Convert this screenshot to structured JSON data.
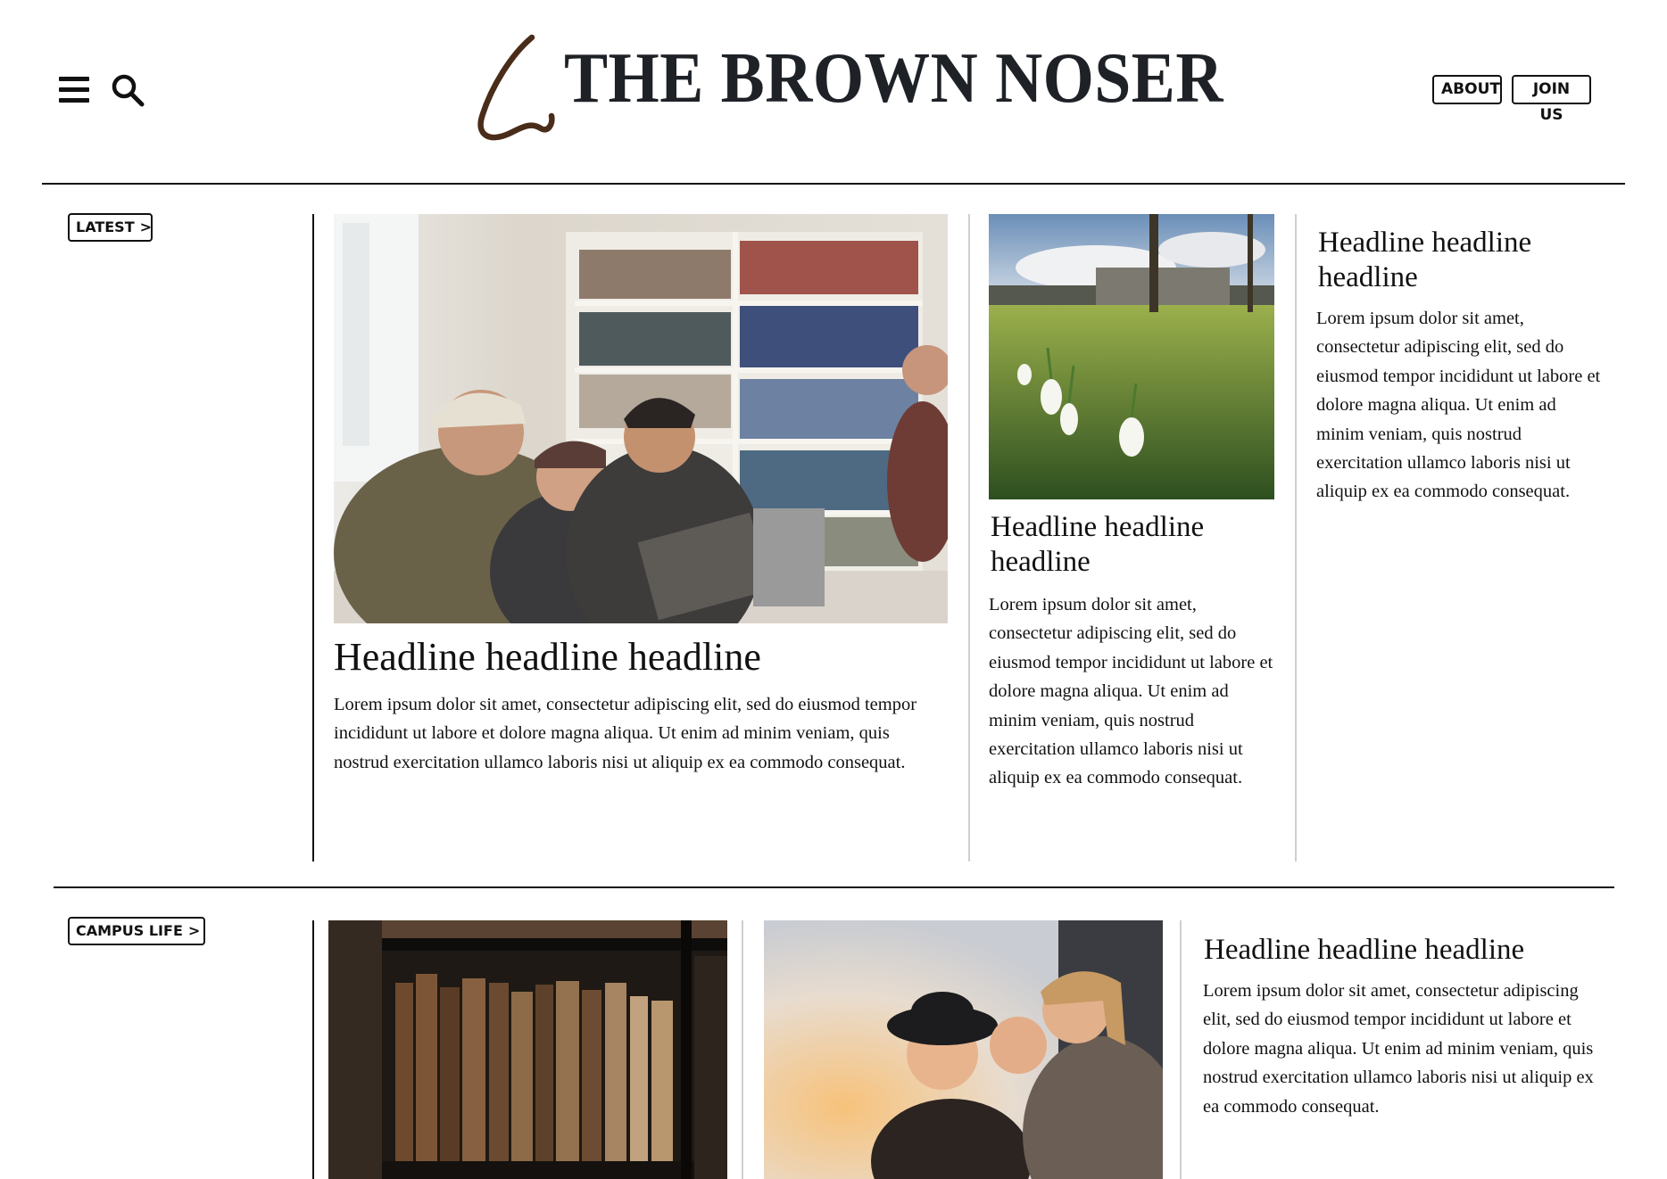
{
  "header": {
    "site_title": "THE BROWN NOSER",
    "about_label": "ABOUT",
    "join_label": "JOIN US",
    "brand_color": "#4a2c1a"
  },
  "sections": {
    "latest": {
      "tag_label": "LATEST",
      "chevron": ">",
      "feature": {
        "image": "students-laughing-at-laptops-in-library",
        "headline": "Headline headline headline",
        "body": "Lorem ipsum dolor sit amet, consectetur adipiscing elit, sed do eiusmod tempor incididunt ut labore et dolore magna aliqua. Ut enim ad minim veniam, quis nostrud exercitation ullamco laboris nisi ut aliquip ex ea commodo consequat."
      },
      "secondary": {
        "image": "snowdrops-on-campus-lawn",
        "headline": "Headline headline headline",
        "body": "Lorem ipsum dolor sit amet, consectetur adipiscing elit, sed do eiusmod tempor incididunt ut labore et dolore magna aliqua. Ut enim ad minim veniam, quis nostrud exercitation ullamco laboris nisi ut aliquip ex ea commodo consequat."
      },
      "tertiary": {
        "headline": "Headline headline headline",
        "body": "Lorem ipsum dolor sit amet, consectetur adipiscing elit, sed do eiusmod tempor incididunt ut labore et dolore magna aliqua. Ut enim ad minim veniam, quis nostrud exercitation ullamco laboris nisi ut aliquip ex ea commodo consequat."
      }
    },
    "campus_life": {
      "tag_label": "CAMPUS LIFE",
      "chevron": ">",
      "image_1": "old-leather-books-on-shelves",
      "image_2": "friends-smiling-in-sunlight",
      "story": {
        "headline": "Headline headline headline",
        "body": "Lorem ipsum dolor sit amet, consectetur adipiscing elit, sed do eiusmod tempor incididunt ut labore et dolore magna aliqua. Ut enim ad minim veniam, quis nostrud exercitation ullamco laboris nisi ut aliquip ex ea commodo consequat."
      }
    }
  }
}
